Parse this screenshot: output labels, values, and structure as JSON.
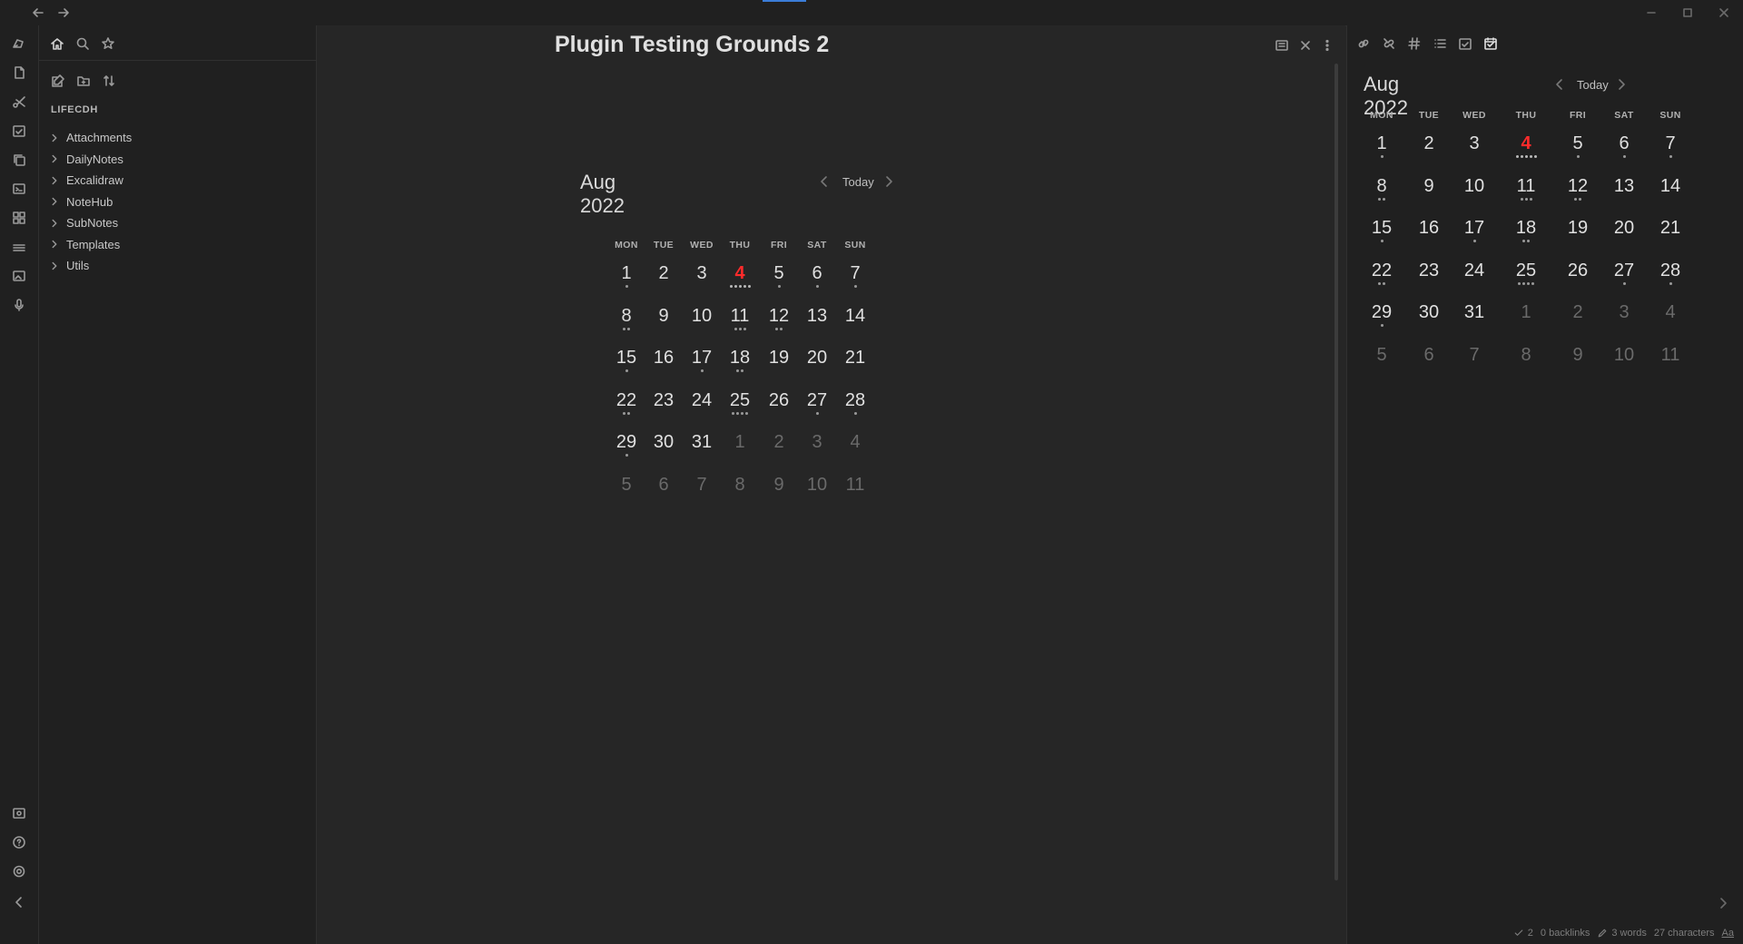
{
  "window": {
    "nav_back": "back-arrow",
    "nav_forward": "forward-arrow"
  },
  "explorer": {
    "vault_name": "LIFECDH",
    "folders": [
      "Attachments",
      "DailyNotes",
      "Excalidraw",
      "NoteHub",
      "SubNotes",
      "Templates",
      "Utils"
    ]
  },
  "main": {
    "note_title": "Plugin Testing Grounds 2"
  },
  "calendar": {
    "month_label": "Aug 2022",
    "today_label": "Today",
    "weekdays": [
      "MON",
      "TUE",
      "WED",
      "THU",
      "FRI",
      "SAT",
      "SUN"
    ],
    "weeks": [
      [
        {
          "d": "1",
          "dots": 1
        },
        {
          "d": "2",
          "dots": 0
        },
        {
          "d": "3",
          "dots": 0
        },
        {
          "d": "4",
          "dots": 5,
          "today": true
        },
        {
          "d": "5",
          "dots": 1
        },
        {
          "d": "6",
          "dots": 1
        },
        {
          "d": "7",
          "dots": 1
        }
      ],
      [
        {
          "d": "8",
          "dots": 2
        },
        {
          "d": "9",
          "dots": 0
        },
        {
          "d": "10",
          "dots": 0
        },
        {
          "d": "11",
          "dots": 3
        },
        {
          "d": "12",
          "dots": 2
        },
        {
          "d": "13",
          "dots": 0
        },
        {
          "d": "14",
          "dots": 0
        }
      ],
      [
        {
          "d": "15",
          "dots": 1
        },
        {
          "d": "16",
          "dots": 0
        },
        {
          "d": "17",
          "dots": 1
        },
        {
          "d": "18",
          "dots": 2
        },
        {
          "d": "19",
          "dots": 0
        },
        {
          "d": "20",
          "dots": 0
        },
        {
          "d": "21",
          "dots": 0
        }
      ],
      [
        {
          "d": "22",
          "dots": 2
        },
        {
          "d": "23",
          "dots": 0
        },
        {
          "d": "24",
          "dots": 0
        },
        {
          "d": "25",
          "dots": 4
        },
        {
          "d": "26",
          "dots": 0
        },
        {
          "d": "27",
          "dots": 1
        },
        {
          "d": "28",
          "dots": 1
        }
      ],
      [
        {
          "d": "29",
          "dots": 1
        },
        {
          "d": "30",
          "dots": 0
        },
        {
          "d": "31",
          "dots": 0
        },
        {
          "d": "1",
          "dots": 0,
          "other": true
        },
        {
          "d": "2",
          "dots": 0,
          "other": true
        },
        {
          "d": "3",
          "dots": 0,
          "other": true
        },
        {
          "d": "4",
          "dots": 0,
          "other": true
        }
      ],
      [
        {
          "d": "5",
          "dots": 0,
          "other": true
        },
        {
          "d": "6",
          "dots": 0,
          "other": true
        },
        {
          "d": "7",
          "dots": 0,
          "other": true
        },
        {
          "d": "8",
          "dots": 0,
          "other": true
        },
        {
          "d": "9",
          "dots": 0,
          "other": true
        },
        {
          "d": "10",
          "dots": 0,
          "other": true
        },
        {
          "d": "11",
          "dots": 0,
          "other": true
        }
      ]
    ]
  },
  "statusbar": {
    "count": "2",
    "backlinks": "0 backlinks",
    "words": "3 words",
    "characters": "27 characters",
    "font_toggle": "Aa"
  },
  "icons": {
    "ribbon": [
      "pen-tool-icon",
      "file-icon",
      "scissors-icon",
      "calendar-check-icon",
      "copy-icon",
      "terminal-icon",
      "grid-icon",
      "layers-icon",
      "image-icon",
      "microphone-icon"
    ],
    "ribbon_bottom": [
      "vault-icon",
      "help-icon",
      "settings-icon",
      "collapse-left-icon"
    ],
    "right_tabs": [
      "link-icon",
      "unlink-icon",
      "hashtag-icon",
      "outline-icon",
      "calendar-check-icon",
      "calendar-icon"
    ]
  },
  "colors": {
    "accent": "#3b7dd8",
    "today": "#ff2b2b",
    "background": "#262626",
    "sidebar": "#202020"
  }
}
